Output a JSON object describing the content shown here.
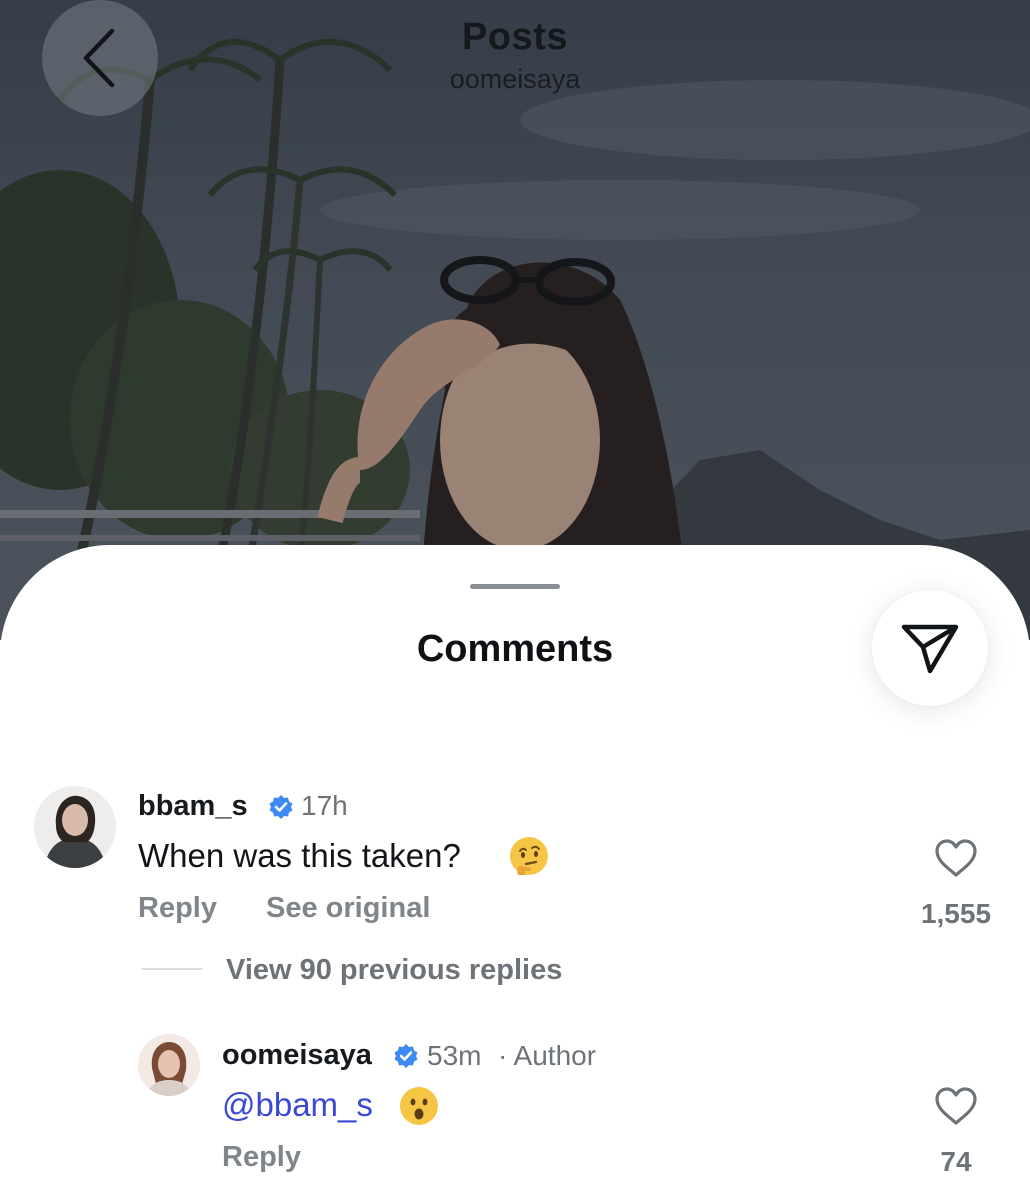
{
  "nav": {
    "title": "Posts",
    "subtitle": "oomeisaya"
  },
  "sheet": {
    "title": "Comments"
  },
  "comments": [
    {
      "username": "bbam_s",
      "verified": true,
      "time": "17h",
      "text": "When was this taken?",
      "emoji": "thinking-face",
      "actions": {
        "reply": "Reply",
        "see_original": "See original"
      },
      "likes": "1,555",
      "view_replies": "View 90 previous replies"
    },
    {
      "username": "oomeisaya",
      "verified": true,
      "time": "53m",
      "author_label": "· Author",
      "mention": "@bbam_s",
      "emoji": "surprised-face",
      "actions": {
        "reply": "Reply"
      },
      "likes": "74"
    }
  ],
  "colors": {
    "verified": "#3d8bf2",
    "mention": "#3a48d6",
    "muted": "#80858c"
  }
}
